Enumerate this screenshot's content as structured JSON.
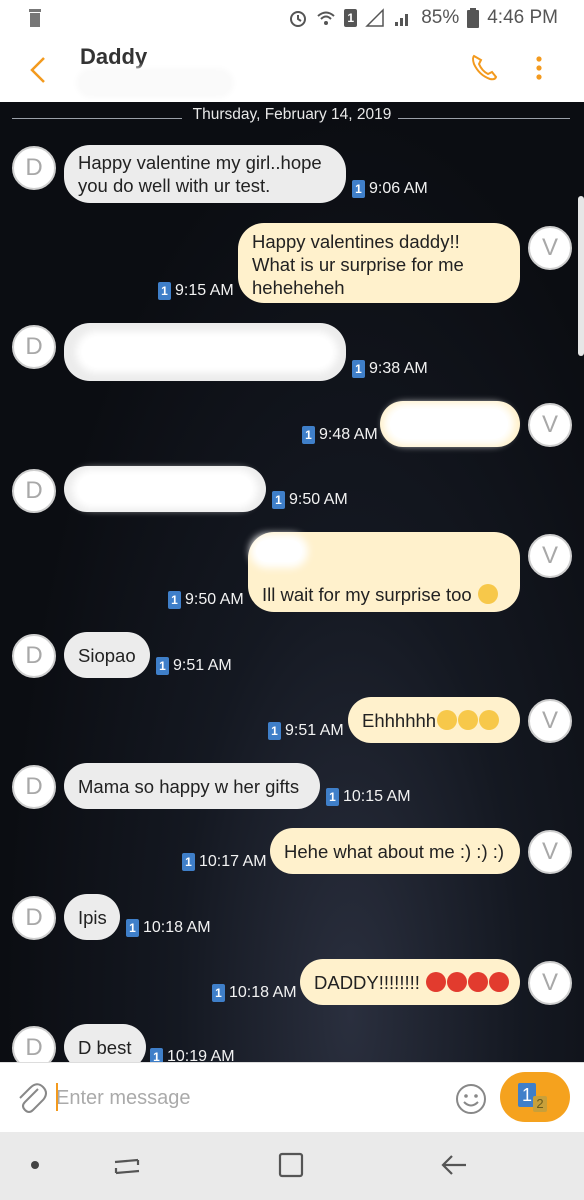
{
  "status_bar": {
    "battery": "85%",
    "time": "4:46 PM",
    "sim_number": "1"
  },
  "header": {
    "contact_name": "Daddy"
  },
  "chat": {
    "date": "Thursday, February 14, 2019",
    "contact_initial": "D",
    "me_initial": "V",
    "sim_label": "1",
    "messages": [
      {
        "dir": "in",
        "text": "Happy valentine my girl..hope\nyou do well with ur test.",
        "time": "9:06 AM"
      },
      {
        "dir": "out",
        "text": "Happy valentines daddy!!\nWhat is ur surprise for me\nheheheheh",
        "time": "9:15 AM"
      },
      {
        "dir": "in",
        "text": "",
        "time": "9:38 AM"
      },
      {
        "dir": "out",
        "text": "",
        "time": "9:48 AM"
      },
      {
        "dir": "in",
        "text": "",
        "time": "9:50 AM"
      },
      {
        "dir": "out",
        "text": "Ill wait for my surprise too",
        "time": "9:50 AM"
      },
      {
        "dir": "in",
        "text": "Siopao",
        "time": "9:51 AM"
      },
      {
        "dir": "out",
        "text": "Ehhhhhh",
        "time": "9:51 AM"
      },
      {
        "dir": "in",
        "text": "Mama so happy w her gifts",
        "time": "10:15 AM"
      },
      {
        "dir": "out",
        "text": "Hehe what about me :) :) :)",
        "time": "10:17 AM"
      },
      {
        "dir": "in",
        "text": "Ipis",
        "time": "10:18 AM"
      },
      {
        "dir": "out",
        "text": "DADDY!!!!!!!!",
        "time": "10:18 AM"
      },
      {
        "dir": "in",
        "text": "D best",
        "time": "10:19 AM"
      }
    ]
  },
  "composer": {
    "placeholder": "Enter message",
    "send_sim_primary": "1",
    "send_sim_secondary": "2"
  },
  "colors": {
    "accent": "#f39a1e",
    "incoming_bubble": "#ececec",
    "outgoing_bubble": "#fff1cc",
    "sim_badge": "#3f7fc9"
  },
  "icons": [
    "trash-icon",
    "alarm-icon",
    "wifi-icon",
    "sim-icon",
    "signal-icon",
    "battery-icon",
    "back-icon",
    "phone-icon",
    "more-vert-icon",
    "paperclip-icon",
    "emoji-icon",
    "send-icon",
    "nav-dot-icon",
    "nav-recents-icon",
    "nav-home-icon",
    "nav-back-icon"
  ]
}
